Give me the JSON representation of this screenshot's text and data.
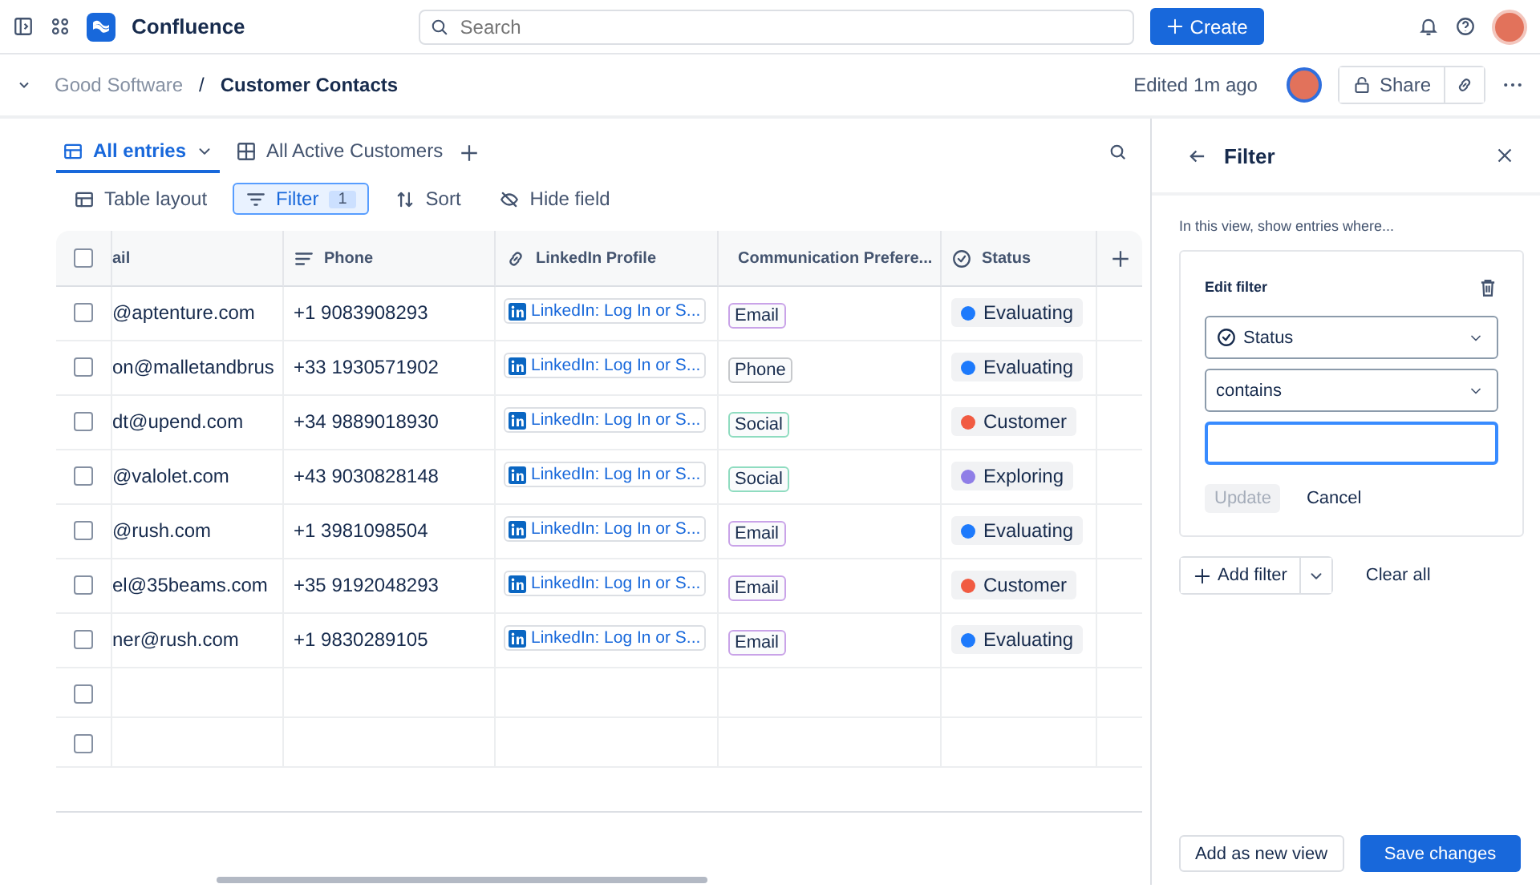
{
  "top_bar": {
    "app_name": "Confluence",
    "search": {
      "placeholder": "Search"
    },
    "create_button": "Create"
  },
  "breadcrumb": {
    "space": "Good Software",
    "separator": "/",
    "page": "Customer Contacts",
    "edited": "Edited 1m ago",
    "share_button": "Share"
  },
  "view_tabs": [
    {
      "label": "All entries",
      "selected": true,
      "kind": "dropdown"
    },
    {
      "label": "All Active Customers",
      "selected": false,
      "kind": "plain"
    }
  ],
  "toolbar": [
    {
      "label": "Table layout",
      "kind": "layout",
      "active": false
    },
    {
      "label": "Filter",
      "kind": "filter",
      "active": true,
      "count": "1"
    },
    {
      "label": "Sort",
      "kind": "sort",
      "active": false
    },
    {
      "label": "Hide field",
      "kind": "hide",
      "active": false
    }
  ],
  "table": {
    "select_all": {
      "checked": false
    },
    "columns": [
      {
        "label": "ail",
        "kind": "email"
      },
      {
        "label": "Phone",
        "kind": "text"
      },
      {
        "label": "LinkedIn Profile",
        "kind": "link"
      },
      {
        "label": "Communication Prefere...",
        "kind": "tag"
      },
      {
        "label": "Status",
        "kind": "status"
      }
    ],
    "rows": [
      {
        "checked": false,
        "email": "@aptenture.com",
        "phone": "+1 9083908293",
        "linkedin": "LinkedIn: Log In or S...",
        "preference": {
          "label": "Email",
          "color": "#c9a3e8"
        },
        "status": {
          "label": "Evaluating",
          "color": "#1d7afc"
        }
      },
      {
        "checked": false,
        "email": "on@malletandbrus",
        "phone": "+33 1930571902",
        "linkedin": "LinkedIn: Log In or S...",
        "preference": {
          "label": "Phone",
          "color": "#c7c9cc"
        },
        "status": {
          "label": "Evaluating",
          "color": "#1d7afc"
        }
      },
      {
        "checked": false,
        "email": "dt@upend.com",
        "phone": "+34 9889018930",
        "linkedin": "LinkedIn: Log In or S...",
        "preference": {
          "label": "Social",
          "color": "#8fdcc0"
        },
        "status": {
          "label": "Customer",
          "color": "#f15b42"
        }
      },
      {
        "checked": false,
        "email": "@valolet.com",
        "phone": "+43 9030828148",
        "linkedin": "LinkedIn: Log In or S...",
        "preference": {
          "label": "Social",
          "color": "#8fdcc0"
        },
        "status": {
          "label": "Exploring",
          "color": "#8f7ee7"
        }
      },
      {
        "checked": false,
        "email": "@rush.com",
        "phone": "+1 3981098504",
        "linkedin": "LinkedIn: Log In or S...",
        "preference": {
          "label": "Email",
          "color": "#c9a3e8"
        },
        "status": {
          "label": "Evaluating",
          "color": "#1d7afc"
        }
      },
      {
        "checked": false,
        "email": "el@35beams.com",
        "phone": "+35 9192048293",
        "linkedin": "LinkedIn: Log In or S...",
        "preference": {
          "label": "Email",
          "color": "#c9a3e8"
        },
        "status": {
          "label": "Customer",
          "color": "#f15b42"
        }
      },
      {
        "checked": false,
        "email": "ner@rush.com",
        "phone": "+1 9830289105",
        "linkedin": "LinkedIn: Log In or S...",
        "preference": {
          "label": "Email",
          "color": "#c9a3e8"
        },
        "status": {
          "label": "Evaluating",
          "color": "#1d7afc"
        }
      },
      {
        "checked": false
      },
      {
        "checked": false
      }
    ]
  },
  "filter_panel": {
    "title": "Filter",
    "intro": "In this view, show entries where...",
    "card_title": "Edit filter",
    "field_select": "Status",
    "operator_select": "contains",
    "value_input": {
      "focused": true
    },
    "update_button": {
      "label": "Update",
      "disabled": true
    },
    "cancel_button": "Cancel",
    "add_filter_button": "Add filter",
    "clear_all": "Clear all",
    "add_view_button": "Add as new view",
    "save_button": "Save changes"
  }
}
